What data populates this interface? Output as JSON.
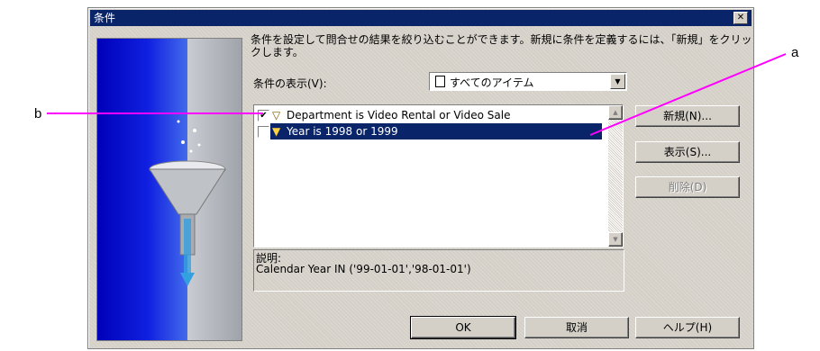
{
  "window": {
    "title": "条件",
    "close_icon": "close-icon"
  },
  "description": "条件を設定して問合せの結果を絞り込むことができます。新規に条件を定義するには、「新規」をクリックします。",
  "view_label": "条件の表示(V):",
  "view_select": {
    "value": "すべてのアイテム",
    "icon": "document-icon"
  },
  "conditions": [
    {
      "checked": true,
      "checkmark": "✔",
      "text": "Department is Video Rental or Video Sale",
      "selected": false
    },
    {
      "checked": false,
      "checkmark": "",
      "text": "Year is 1998 or 1999",
      "selected": true
    }
  ],
  "explanation": {
    "label": "説明:",
    "text": "Calendar Year IN ('99-01-01','98-01-01')"
  },
  "side_buttons": {
    "new": "新規(N)...",
    "show": "表示(S)...",
    "delete": "削除(D)"
  },
  "bottom_buttons": {
    "ok": "OK",
    "cancel": "取消",
    "help": "ヘルプ(H)"
  },
  "callouts": {
    "a": "a",
    "b": "b"
  },
  "colors": {
    "titlebar": "#0a246a",
    "callout": "#ff00ff",
    "selection": "#0a246a"
  }
}
